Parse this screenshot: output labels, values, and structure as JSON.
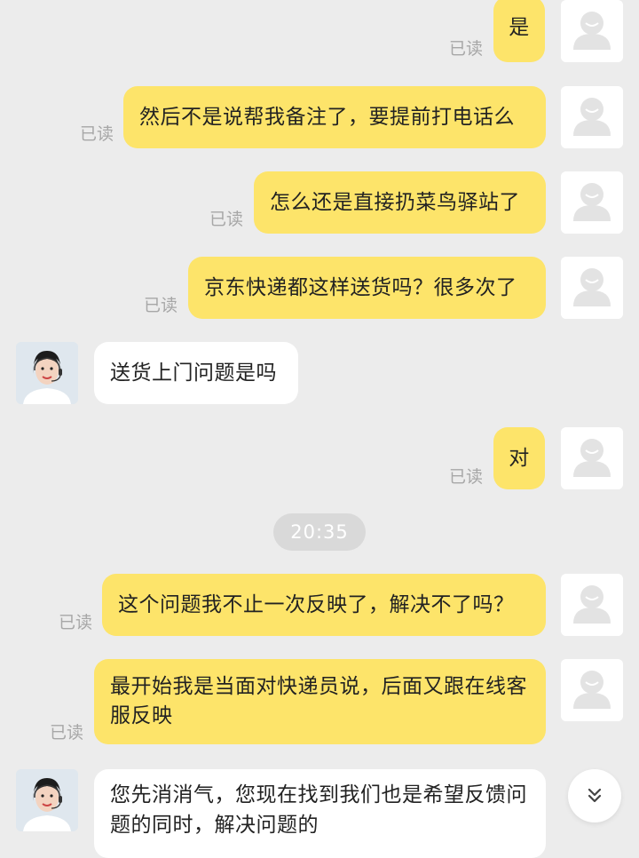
{
  "messages": [
    {
      "from": "me",
      "text": "是",
      "status": "已读"
    },
    {
      "from": "me",
      "text": "然后不是说帮我备注了，要提前打电话么",
      "status": "已读"
    },
    {
      "from": "me",
      "text": "怎么还是直接扔菜鸟驿站了",
      "status": "已读"
    },
    {
      "from": "me",
      "text": "京东快递都这样送货吗？很多次了",
      "status": "已读"
    },
    {
      "from": "agent",
      "text": "送货上门问题是吗"
    },
    {
      "from": "me",
      "text": "对",
      "status": "已读"
    },
    {
      "from": "me",
      "text": "这个问题我不止一次反映了，解决不了吗？",
      "status": "已读"
    },
    {
      "from": "me",
      "text": "最开始我是当面对快递员说，后面又跟在线客服反映",
      "status": "已读"
    },
    {
      "from": "agent",
      "text": "您先消消气，您现在找到我们也是希望反馈问题的同时，解决问题的"
    }
  ],
  "timestamp": "20:35",
  "icons": {
    "user_avatar": "default-user-avatar-icon",
    "agent_avatar": "customer-service-agent-avatar",
    "scroll_button": "double-chevron-down-icon"
  },
  "colors": {
    "background": "#ececec",
    "my_bubble": "#fde46a",
    "agent_bubble": "#ffffff",
    "read_text": "#a7a7a7"
  }
}
